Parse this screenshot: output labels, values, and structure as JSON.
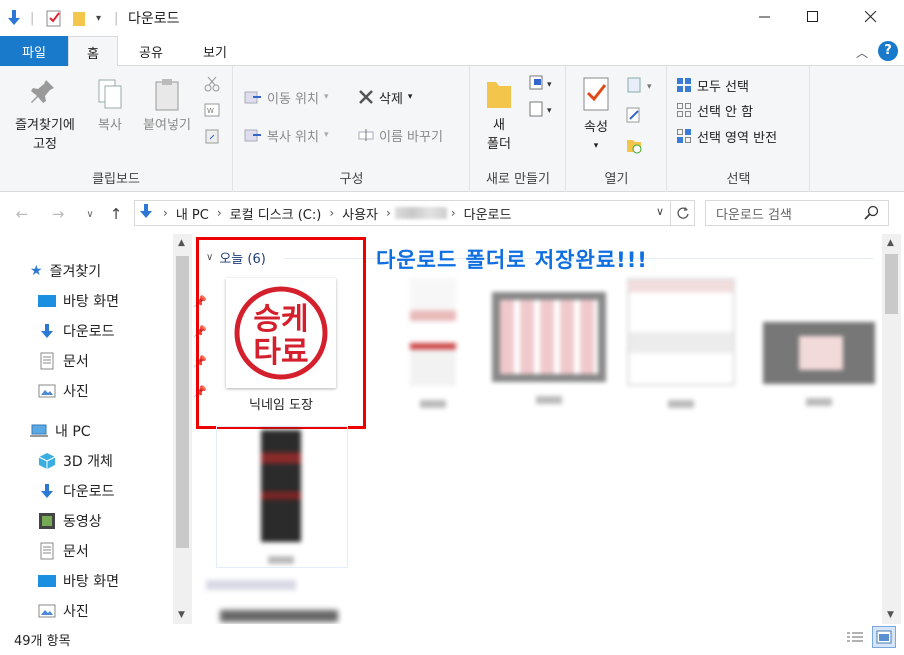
{
  "window": {
    "title": "다운로드"
  },
  "tabs": [
    {
      "label": "파일"
    },
    {
      "label": "홈"
    },
    {
      "label": "공유"
    },
    {
      "label": "보기"
    }
  ],
  "ribbon": {
    "clipboard": {
      "label": "클립보드",
      "pin_quick_access": "즐겨찾기에\n고정",
      "pin_line1": "즐겨찾기에",
      "pin_line2": "고정",
      "copy": "복사",
      "paste": "붙여넣기"
    },
    "organize": {
      "label": "구성",
      "move_to": "이동 위치",
      "copy_to": "복사 위치",
      "delete": "삭제",
      "rename": "이름 바꾸기"
    },
    "new": {
      "label": "새로 만들기",
      "new_folder_line1": "새",
      "new_folder_line2": "폴더"
    },
    "open": {
      "label": "열기",
      "properties": "속성"
    },
    "select": {
      "label": "선택",
      "select_all": "모두 선택",
      "select_none": "선택 안 함",
      "invert": "선택 영역 반전"
    }
  },
  "address": {
    "crumbs": [
      "내 PC",
      "로컬 디스크 (C:)",
      "사용자",
      "",
      "다운로드"
    ]
  },
  "search": {
    "placeholder": "다운로드 검색"
  },
  "navpane": {
    "quick_access": "즐겨찾기",
    "items": [
      {
        "label": "바탕 화면"
      },
      {
        "label": "다운로드"
      },
      {
        "label": "문서"
      },
      {
        "label": "사진"
      }
    ],
    "this_pc": "내 PC",
    "pc_items": [
      {
        "label": "3D 개체"
      },
      {
        "label": "다운로드"
      },
      {
        "label": "동영상"
      },
      {
        "label": "문서"
      },
      {
        "label": "바탕 화면"
      },
      {
        "label": "사진"
      }
    ]
  },
  "content": {
    "group_header": "오늘 (6)",
    "annotation": "다운로드 폴더로 저장완료!!!",
    "files": [
      {
        "name": "닉네임 도장"
      }
    ],
    "seal_text": "승케\n타료"
  },
  "status": {
    "count": "49개 항목"
  },
  "colors": {
    "accent": "#1979ca",
    "annotation": "#0f6fe0",
    "highlight": "#e00000",
    "seal": "#d4202c"
  }
}
